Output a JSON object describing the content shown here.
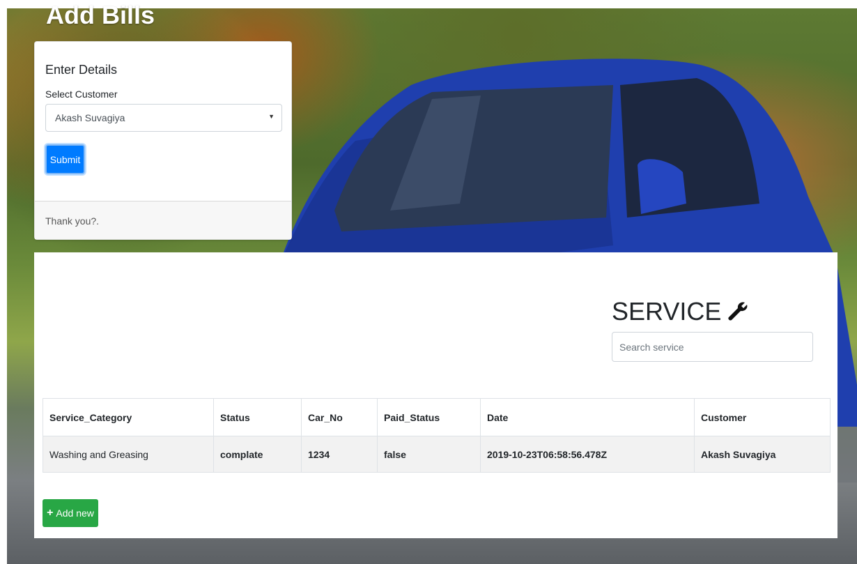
{
  "page": {
    "title": "Add Bills"
  },
  "form": {
    "card_title": "Enter Details",
    "customer_label": "Select Customer",
    "customer_selected": "Akash Suvagiya",
    "submit_label": "Submit",
    "footer_text": "Thank you?."
  },
  "service": {
    "title": "SERVICE",
    "title_icon": "wrench-icon",
    "search_placeholder": "Search service",
    "table": {
      "headers": [
        "Service_Category",
        "Status",
        "Car_No",
        "Paid_Status",
        "Date",
        "Customer"
      ],
      "rows": [
        [
          "Washing and Greasing",
          "complate",
          "1234",
          "false",
          "2019-10-23T06:58:56.478Z",
          "Akash Suvagiya"
        ]
      ]
    },
    "add_label": "Add new",
    "add_icon": "plus-icon"
  },
  "colors": {
    "primary": "#007bff",
    "success": "#28a745",
    "car_blue": "#1e3fa8"
  }
}
